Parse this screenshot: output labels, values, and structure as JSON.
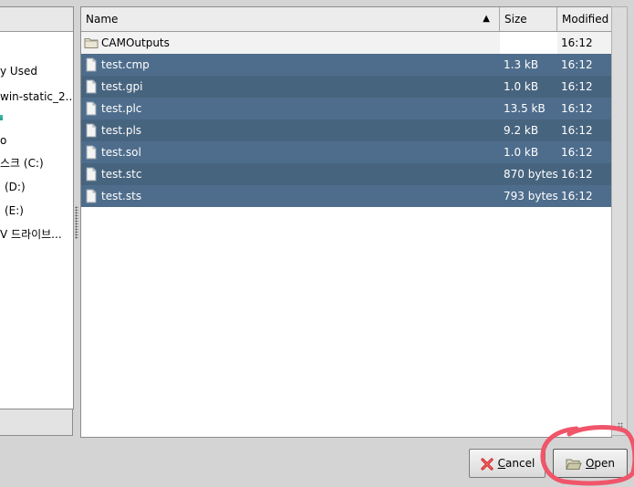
{
  "places": {
    "items": [
      {
        "label": "y Used",
        "icon": "none"
      },
      {
        "label": "win-static_2...",
        "icon": "none"
      },
      {
        "label": "",
        "icon": "teal-marker"
      },
      {
        "label": "o",
        "icon": "none"
      },
      {
        "label": "스크 (C:)",
        "icon": "none"
      },
      {
        "label": "(D:)",
        "icon": "none"
      },
      {
        "label": "(E:)",
        "icon": "none"
      },
      {
        "label": "V 드라이브...",
        "icon": "none"
      }
    ]
  },
  "filelist": {
    "columns": {
      "name": "Name",
      "size": "Size",
      "modified": "Modified"
    },
    "sort_indicator": "▲",
    "rows": [
      {
        "name": "CAMOutputs",
        "size": "",
        "modified": "16:12",
        "type": "folder",
        "selected": false
      },
      {
        "name": "test.cmp",
        "size": "1.3 kB",
        "modified": "16:12",
        "type": "file",
        "selected": true
      },
      {
        "name": "test.gpi",
        "size": "1.0 kB",
        "modified": "16:12",
        "type": "file",
        "selected": true
      },
      {
        "name": "test.plc",
        "size": "13.5 kB",
        "modified": "16:12",
        "type": "file",
        "selected": true
      },
      {
        "name": "test.pls",
        "size": "9.2 kB",
        "modified": "16:12",
        "type": "file",
        "selected": true
      },
      {
        "name": "test.sol",
        "size": "1.0 kB",
        "modified": "16:12",
        "type": "file",
        "selected": true
      },
      {
        "name": "test.stc",
        "size": "870 bytes",
        "modified": "16:12",
        "type": "file",
        "selected": true
      },
      {
        "name": "test.sts",
        "size": "793 bytes",
        "modified": "16:12",
        "type": "file",
        "selected": true
      }
    ]
  },
  "buttons": {
    "cancel": {
      "mnemonic": "C",
      "rest": "ancel",
      "icon": "red-x-icon"
    },
    "open": {
      "mnemonic": "O",
      "rest": "pen",
      "icon": "folder-icon"
    }
  },
  "colors": {
    "selection": "#4e6d8c",
    "annotation": "#f0556a"
  }
}
